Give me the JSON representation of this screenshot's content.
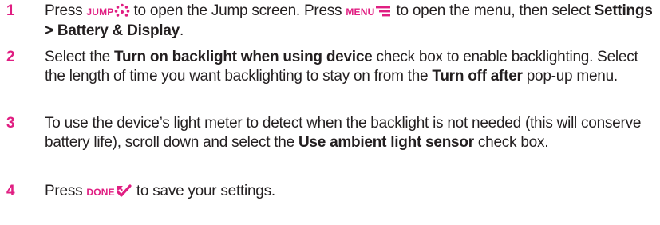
{
  "steps": [
    {
      "number": "1",
      "t1": "Press ",
      "key1": "JUMP",
      "t2": " to open the Jump screen. Press ",
      "key2": "MENU",
      "t3": " to open the menu, then select ",
      "b1": "Settings > Battery & Display",
      "t4": "."
    },
    {
      "number": "2",
      "t1": "Select the ",
      "b1": "Turn on backlight when using device",
      "t2": " check box to enable backlighting. Select the length of time you want backlighting to stay on from the ",
      "b2": "Turn off after",
      "t3": " pop-up menu."
    },
    {
      "number": "3",
      "t1": "To use the device’s light meter to detect when the backlight is not needed (this will conserve battery life), scroll down and select the ",
      "b1": "Use ambient light sensor",
      "t2": " check box."
    },
    {
      "number": "4",
      "t1": "Press ",
      "key1": "DONE",
      "t2": " to save your settings."
    }
  ],
  "icons": {
    "jump": "jump-dots-icon",
    "menu": "menu-lines-icon",
    "done": "done-check-icon"
  },
  "colors": {
    "accent": "#e01e82",
    "text": "#231f20"
  }
}
